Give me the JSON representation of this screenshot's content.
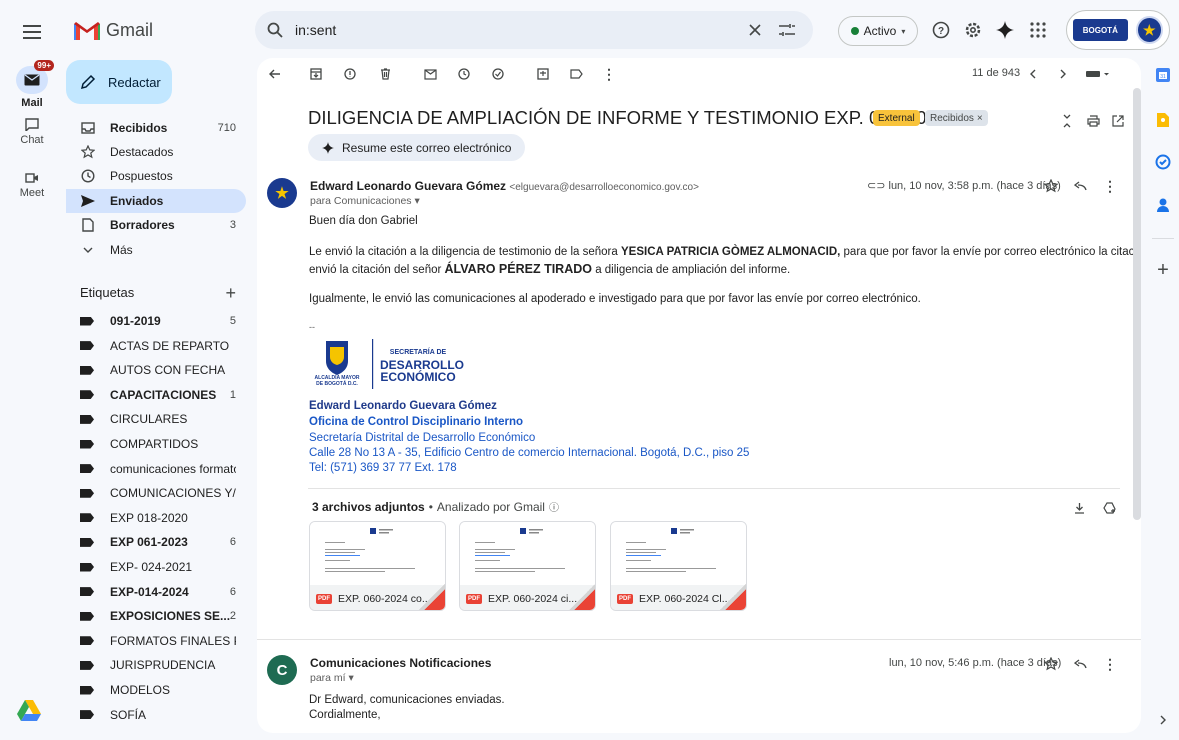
{
  "app": {
    "name": "Gmail"
  },
  "search": {
    "value": "in:sent"
  },
  "status": {
    "label": "Activo"
  },
  "account": {
    "org_logo_text": "BOGOTÁ"
  },
  "rail": {
    "mail": {
      "label": "Mail",
      "badge": "99+"
    },
    "chat": {
      "label": "Chat"
    },
    "meet": {
      "label": "Meet"
    }
  },
  "sidebar": {
    "compose_label": "Redactar",
    "items": [
      {
        "label": "Recibidos",
        "count": "710",
        "icon": "inbox-icon"
      },
      {
        "label": "Destacados",
        "count": "",
        "icon": "star-icon"
      },
      {
        "label": "Pospuestos",
        "count": "",
        "icon": "clock-icon"
      },
      {
        "label": "Enviados",
        "count": "",
        "icon": "send-icon"
      },
      {
        "label": "Borradores",
        "count": "3",
        "icon": "draft-icon"
      },
      {
        "label": "Más",
        "count": "",
        "icon": "chevron-down-icon"
      }
    ],
    "labels_title": "Etiquetas",
    "labels": [
      {
        "label": "091-2019",
        "count": "5"
      },
      {
        "label": "ACTAS DE REPARTO",
        "count": ""
      },
      {
        "label": "AUTOS CON FECHA",
        "count": ""
      },
      {
        "label": "CAPACITACIONES",
        "count": "1"
      },
      {
        "label": "CIRCULARES",
        "count": ""
      },
      {
        "label": "COMPARTIDOS",
        "count": ""
      },
      {
        "label": "comunicaciones formato...",
        "count": ""
      },
      {
        "label": "COMUNICACIONES Y/O ...",
        "count": ""
      },
      {
        "label": "EXP 018-2020",
        "count": ""
      },
      {
        "label": "EXP 061-2023",
        "count": "6"
      },
      {
        "label": "EXP- 024-2021",
        "count": ""
      },
      {
        "label": "EXP-014-2024",
        "count": "6"
      },
      {
        "label": "EXPOSICIONES SE...",
        "count": "2"
      },
      {
        "label": "FORMATOS FINALES PR...",
        "count": ""
      },
      {
        "label": "JURISPRUDENCIA",
        "count": ""
      },
      {
        "label": "MODELOS",
        "count": ""
      },
      {
        "label": "SOFÍA",
        "count": ""
      }
    ]
  },
  "toolbar": {
    "page_count": "11 de 943"
  },
  "thread": {
    "subject": "DILIGENCIA DE AMPLIACIÓN DE INFORME Y TESTIMONIO EXP. 060-2024",
    "chip_external": "External",
    "chip_inbox": "Recibidos",
    "summarize_label": "Resume este correo electrónico",
    "messages": [
      {
        "sender_name": "Edward Leonardo Guevara Gómez",
        "sender_email": "<elguevara@desarrolloeconomico.gov.co>",
        "recipients": "para Comunicaciones",
        "date": "lun, 10 nov, 3:58 p.m. (hace 3 días)",
        "greeting": "Buen día don Gabriel",
        "p1_a": "Le envió la citación a la diligencia de testimonio de la señora ",
        "p1_b": "YESICA PATRICIA GÒMEZ ALMONACID,",
        "p1_c": " para que por favor la envíe por correo electrónico la citación, así mismo, le",
        "p1_d": "envió la citación del señor ",
        "p1_e": "ÁLVARO PÉREZ TIRADO",
        "p1_f": " a diligencia de ampliación del informe.",
        "p2": "Igualmente, le envió las comunicaciones al apoderado e investigado para que por favor las envíe por correo electrónico.",
        "sep": "--",
        "logo_line1": "SECRETARÍA DE",
        "logo_line2": "DESARROLLO",
        "logo_line3": "ECONÓMICO",
        "logo_small1": "ALCALDÍA MAYOR",
        "logo_small2": "DE BOGOTÁ D.C.",
        "sig_name": "Edward Leonardo Guevara Gómez",
        "sig_office": "Oficina de Control Disciplinario Interno",
        "sig_dept": "Secretaría Distrital de Desarrollo Económico",
        "sig_address": "Calle 28 No 13 A - 35, Edificio Centro de comercio Internacional. Bogotá, D.C., piso 25",
        "sig_phone": "Tel: (571) 369 37 77 Ext. 178",
        "attachments_title": "3 archivos adjuntos",
        "attachments_scan": "Analizado por Gmail",
        "attachments": [
          {
            "name": "EXP. 060-2024 co..."
          },
          {
            "name": "EXP. 060-2024 ci..."
          },
          {
            "name": "EXP. 060-2024 Cl..."
          }
        ]
      },
      {
        "avatar_letter": "C",
        "sender_name": "Comunicaciones Notificaciones",
        "recipients": "para mí",
        "date": "lun, 10 nov, 5:46 p.m. (hace 3 días)",
        "line1": "Dr Edward, comunicaciones enviadas.",
        "line2": "Cordialmente,"
      }
    ]
  },
  "colors": {
    "accent": "#0b57d0",
    "compose_bg": "#c2e7ff",
    "active_bg": "#d3e3fd",
    "external_chip": "#f8c33b"
  }
}
